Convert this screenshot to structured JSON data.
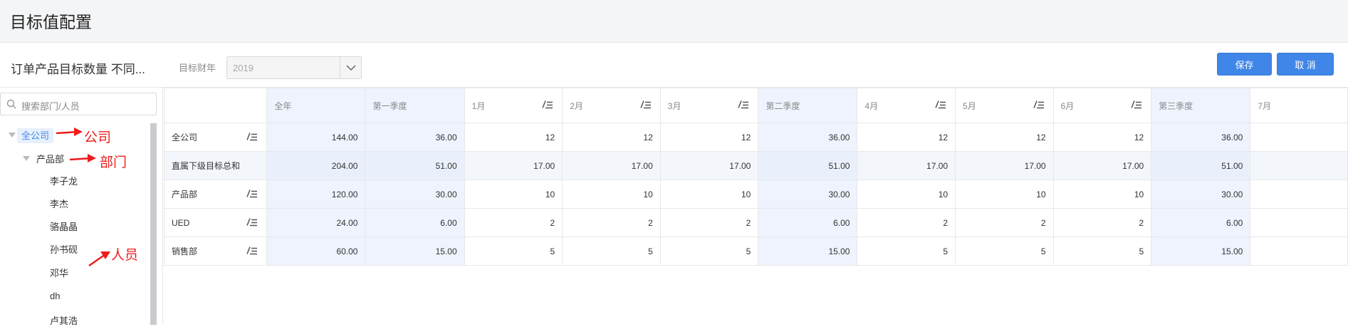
{
  "page": {
    "title": "目标值配置"
  },
  "toolbar": {
    "config_title": "订单产品目标数量 不同...",
    "year_label": "目标财年",
    "year_value": "2019",
    "save_label": "保存",
    "cancel_label": "取 消"
  },
  "sidebar": {
    "search_placeholder": "搜索部门/人员",
    "tree": {
      "root": "全公司",
      "dept": "产品部",
      "people": [
        "李子龙",
        "李杰",
        "骆晶晶",
        "孙书砚",
        "邓华",
        "dh",
        "卢其浩"
      ]
    },
    "annotations": {
      "company": "公司",
      "dept": "部门",
      "person": "人员"
    }
  },
  "table": {
    "headers": [
      "全年",
      "第一季度",
      "1月",
      "2月",
      "3月",
      "第二季度",
      "4月",
      "5月",
      "6月",
      "第三季度",
      "7月"
    ],
    "rows": [
      {
        "label": "全公司",
        "cells": [
          "144.00",
          "36.00",
          "12",
          "12",
          "12",
          "36.00",
          "12",
          "12",
          "12",
          "36.00",
          ""
        ]
      },
      {
        "label": "直属下级目标总和",
        "cells": [
          "204.00",
          "51.00",
          "17.00",
          "17.00",
          "17.00",
          "51.00",
          "17.00",
          "17.00",
          "17.00",
          "51.00",
          ""
        ]
      },
      {
        "label": "产品部",
        "cells": [
          "120.00",
          "30.00",
          "10",
          "10",
          "10",
          "30.00",
          "10",
          "10",
          "10",
          "30.00",
          ""
        ]
      },
      {
        "label": "UED",
        "cells": [
          "24.00",
          "6.00",
          "2",
          "2",
          "2",
          "6.00",
          "2",
          "2",
          "2",
          "6.00",
          ""
        ]
      },
      {
        "label": "销售部",
        "cells": [
          "60.00",
          "15.00",
          "5",
          "5",
          "5",
          "15.00",
          "5",
          "5",
          "5",
          "15.00",
          ""
        ]
      }
    ]
  },
  "colors": {
    "accent": "#3f86e8",
    "annotation": "#ee1c1c",
    "quarter_bg": "#eef3fd"
  }
}
